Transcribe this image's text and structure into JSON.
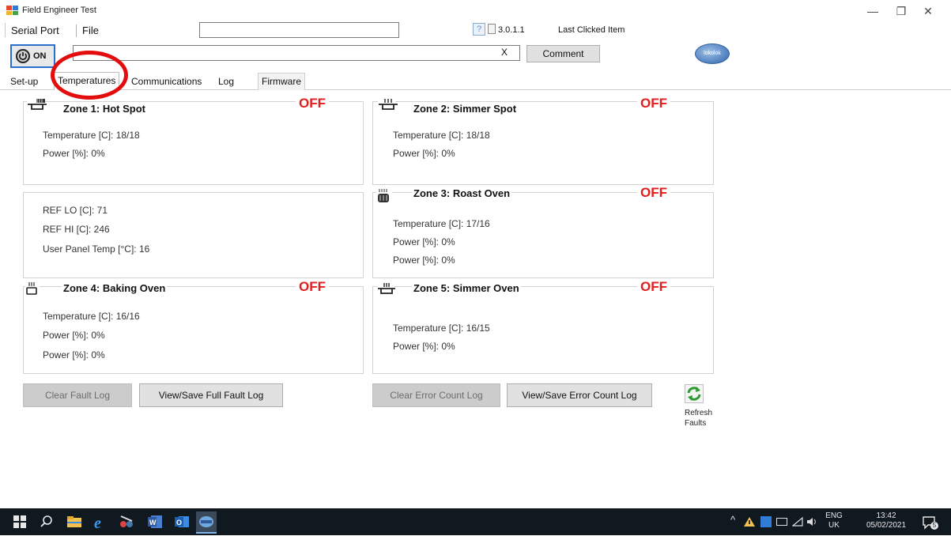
{
  "window": {
    "title": "Field Engineer Test",
    "controls": {
      "minimize": "—",
      "restore": "❐",
      "close": "✕"
    }
  },
  "menu": {
    "serial_port": "Serial Port",
    "file": "File"
  },
  "toolbar": {
    "top_input_value": "",
    "help_symbol": "?",
    "version": "3.0.1.1",
    "last_clicked": "Last Clicked Item",
    "on_label": "ON",
    "comment_value": "",
    "clear_symbol": "X",
    "comment_label": "Comment",
    "logo_text": "lokolok"
  },
  "tabs": [
    "Set-up",
    "Temperatures",
    "Communications",
    "Log",
    "Firmware"
  ],
  "zones": [
    {
      "title": "Zone 1: Hot Spot",
      "status": "OFF",
      "fields": [
        "Temperature [C]: 18/18",
        "Power [%]: 0%"
      ]
    },
    {
      "title": "Zone 2: Simmer Spot",
      "status": "OFF",
      "fields": [
        "Temperature [C]: 18/18",
        "Power [%]: 0%"
      ]
    },
    {
      "title": "Zone 3: Roast Oven",
      "status": "OFF",
      "fields": [
        "Temperature [C]: 17/16",
        "Power [%]: 0%",
        "Power [%]: 0%"
      ]
    },
    {
      "title": "Zone 4: Baking Oven",
      "status": "OFF",
      "fields": [
        "Temperature [C]: 16/16",
        "Power [%]: 0%",
        "Power [%]: 0%"
      ]
    },
    {
      "title": "Zone 5: Simmer Oven",
      "status": "OFF",
      "fields": [
        "Temperature [C]: 16/15",
        "Power [%]: 0%"
      ]
    }
  ],
  "reference": [
    "REF LO [C]: 71",
    "REF HI [C]: 246",
    "User Panel Temp [°C]: 16"
  ],
  "buttons": {
    "clear_fault_log": "Clear Fault Log",
    "view_save_fault_log": "View/Save Full Fault Log",
    "clear_error_count_log": "Clear Error Count Log",
    "view_save_error_count_log": "View/Save Error Count Log",
    "refresh_faults": "Refresh Faults"
  },
  "taskbar": {
    "tray_chevron": "^",
    "language": "ENG",
    "region": "UK",
    "time": "13:42",
    "date": "05/02/2021",
    "notification_count": "5"
  },
  "colors": {
    "status_off": "#e11d1d",
    "annotation": "#e30d0d",
    "accent": "#2a6fc9",
    "taskbar": "#101820"
  }
}
